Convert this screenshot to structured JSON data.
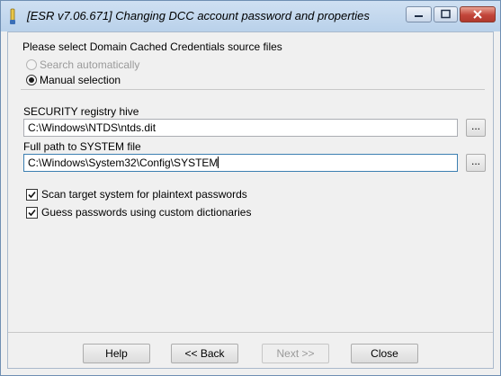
{
  "window": {
    "title": "[ESR v7.06.671]  Changing DCC account password and properties",
    "colors": {
      "titlebar": "#b9d1ea",
      "close_button": "#c2453a",
      "focus_border": "#3c7fb1"
    }
  },
  "source": {
    "group_title": "Please select Domain Cached Credentials source files",
    "options": [
      {
        "label": "Search automatically",
        "selected": false,
        "enabled": false
      },
      {
        "label": "Manual selection",
        "selected": true,
        "enabled": true
      }
    ]
  },
  "security_hive": {
    "label": "SECURITY registry hive",
    "value": "C:\\Windows\\NTDS\\ntds.dit",
    "browse_label": "..."
  },
  "system_file": {
    "label": "Full path to SYSTEM file",
    "value": "C:\\Windows\\System32\\Config\\SYSTEM",
    "browse_label": "..."
  },
  "options": [
    {
      "label": "Scan target system for plaintext passwords",
      "checked": true
    },
    {
      "label": "Guess passwords using custom dictionaries",
      "checked": true
    }
  ],
  "buttons": {
    "help": "Help",
    "back": "<< Back",
    "next": "Next >>",
    "close": "Close"
  }
}
